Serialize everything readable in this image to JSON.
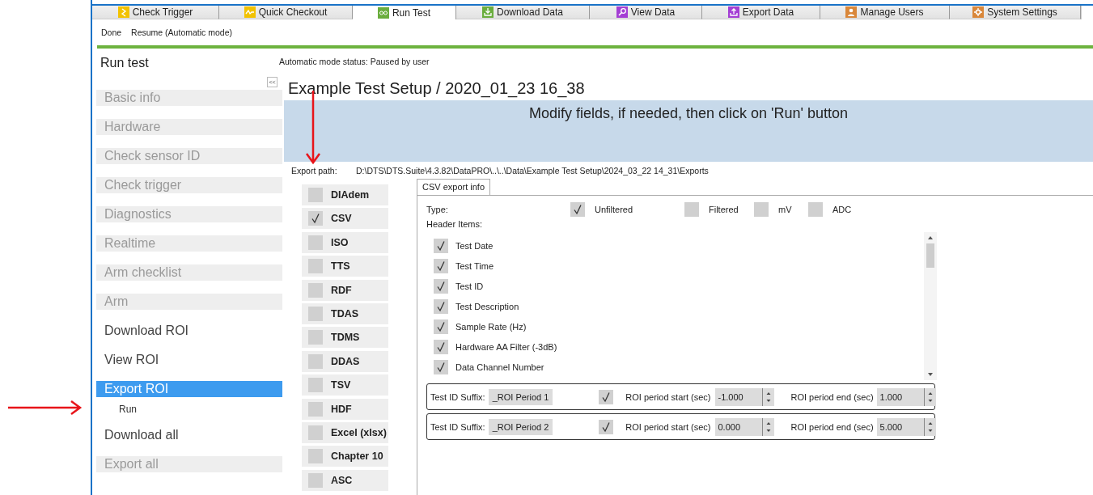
{
  "tabs": [
    {
      "label": "Check Trigger",
      "selected": false
    },
    {
      "label": "Quick Checkout",
      "selected": false
    },
    {
      "label": "Run Test",
      "selected": true
    },
    {
      "label": "Download Data",
      "selected": false
    },
    {
      "label": "View Data",
      "selected": false
    },
    {
      "label": "Export Data",
      "selected": false
    },
    {
      "label": "Manage Users",
      "selected": false
    },
    {
      "label": "System Settings",
      "selected": false
    }
  ],
  "toolbar": [
    "Done",
    "Resume (Automatic mode)"
  ],
  "sidebar": {
    "title": "Run test",
    "collapse_button": "<<",
    "items": [
      {
        "label": "Basic info",
        "disabled": true,
        "selected": false
      },
      {
        "label": "Hardware",
        "disabled": true,
        "selected": false
      },
      {
        "label": "Check sensor ID",
        "disabled": true,
        "selected": false
      },
      {
        "label": "Check trigger",
        "disabled": true,
        "selected": false
      },
      {
        "label": "Diagnostics",
        "disabled": true,
        "selected": false
      },
      {
        "label": "Realtime",
        "disabled": true,
        "selected": false
      },
      {
        "label": "Arm checklist",
        "disabled": true,
        "selected": false
      },
      {
        "label": "Arm",
        "disabled": true,
        "selected": false
      },
      {
        "label": "Download ROI",
        "disabled": false,
        "selected": false
      },
      {
        "label": "View ROI",
        "disabled": false,
        "selected": false
      },
      {
        "label": "Export ROI",
        "disabled": false,
        "selected": true,
        "children": [
          {
            "label": "Run",
            "disabled": false,
            "selected": false
          }
        ]
      },
      {
        "label": "Download all",
        "disabled": false,
        "selected": false
      },
      {
        "label": "Export all",
        "disabled": true,
        "selected": false
      }
    ]
  },
  "status": "Automatic mode status: Paused by user",
  "page_title": "Example Test Setup / 2020_01_23 16_38",
  "banner": "Modify fields, if needed, then click on 'Run' button",
  "export_path": {
    "label": "Export path:",
    "value": "D:\\DTS\\DTS.Suite\\4.3.82\\DataPRO\\..\\..\\Data\\Example Test Setup\\2024_03_22 14_31\\Exports"
  },
  "formats": [
    {
      "label": "DIAdem",
      "checked": false
    },
    {
      "label": "CSV",
      "checked": true
    },
    {
      "label": "ISO",
      "checked": false
    },
    {
      "label": "TTS",
      "checked": false
    },
    {
      "label": "RDF",
      "checked": false
    },
    {
      "label": "TDAS",
      "checked": false
    },
    {
      "label": "TDMS",
      "checked": false
    },
    {
      "label": "DDAS",
      "checked": false
    },
    {
      "label": "TSV",
      "checked": false
    },
    {
      "label": "HDF",
      "checked": false
    },
    {
      "label": "Excel (xlsx)",
      "checked": false
    },
    {
      "label": "Chapter 10",
      "checked": false
    },
    {
      "label": "ASC",
      "checked": false
    }
  ],
  "panel_tabs": [
    {
      "label": "CSV export info",
      "selected": true
    }
  ],
  "type": {
    "label": "Type:",
    "options": [
      {
        "label": "Unfiltered",
        "checked": true
      },
      {
        "label": "Filtered",
        "checked": false
      },
      {
        "label": "mV",
        "checked": false
      },
      {
        "label": "ADC",
        "checked": false
      }
    ]
  },
  "header_items": {
    "label": "Header Items:",
    "items": [
      {
        "label": "Test Date",
        "checked": true
      },
      {
        "label": "Test Time",
        "checked": true
      },
      {
        "label": "Test ID",
        "checked": true
      },
      {
        "label": "Test Description",
        "checked": true
      },
      {
        "label": "Sample Rate (Hz)",
        "checked": true
      },
      {
        "label": "Hardware AA Filter (-3dB)",
        "checked": true
      },
      {
        "label": "Data Channel Number",
        "checked": true
      }
    ]
  },
  "roi_periods": [
    {
      "suffix_label": "Test ID Suffix:",
      "suffix": "_ROI Period 1",
      "enabled": true,
      "start_label": "ROI period start (sec)",
      "start": "-1.000",
      "end_label": "ROI period end (sec)",
      "end": "1.000"
    },
    {
      "suffix_label": "Test ID Suffix:",
      "suffix": "_ROI Period 2",
      "enabled": true,
      "start_label": "ROI period start (sec)",
      "start": "0.000",
      "end_label": "ROI period end (sec)",
      "end": "5.000"
    }
  ]
}
